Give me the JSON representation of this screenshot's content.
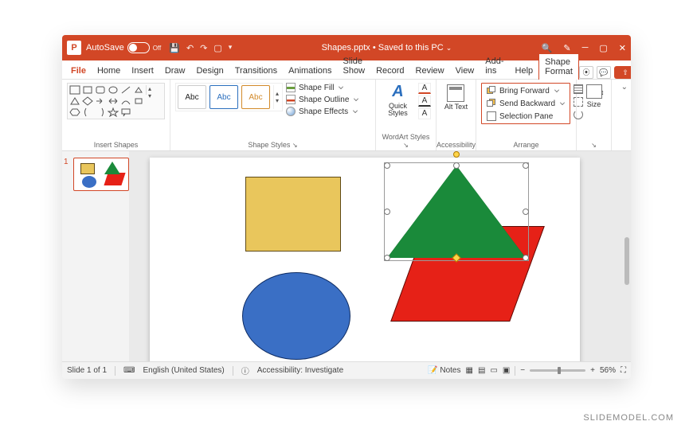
{
  "title": {
    "autosave": "AutoSave",
    "autosave_state": "Off",
    "file_name": "Shapes.pptx",
    "saved": "Saved to this PC"
  },
  "menu": {
    "items": [
      "File",
      "Home",
      "Insert",
      "Draw",
      "Design",
      "Transitions",
      "Animations",
      "Slide Show",
      "Record",
      "Review",
      "View",
      "Add-ins",
      "Help",
      "Shape Format"
    ],
    "active": "Shape Format"
  },
  "ribbon": {
    "insert_shapes_label": "Insert Shapes",
    "shape_styles_label": "Shape Styles",
    "style_abc": "Abc",
    "fill": "Shape Fill",
    "outline": "Shape Outline",
    "effects": "Shape Effects",
    "wordart_label": "WordArt Styles",
    "quick_styles": "Quick Styles",
    "accessibility_label": "Accessibility",
    "alt_text": "Alt Text",
    "arrange_label": "Arrange",
    "bring_forward": "Bring Forward",
    "send_backward": "Send Backward",
    "selection_pane": "Selection Pane",
    "size_label": "Size"
  },
  "status": {
    "slide_of": "Slide 1 of 1",
    "lang": "English (United States)",
    "access": "Accessibility: Investigate",
    "notes": "Notes",
    "zoom": "56%"
  },
  "thumb_num": "1",
  "watermark": "SLIDEMODEL.COM"
}
